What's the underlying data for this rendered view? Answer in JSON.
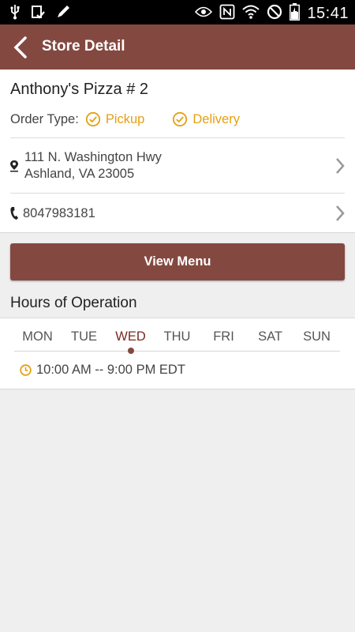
{
  "status_bar": {
    "time": "15:41"
  },
  "app_bar": {
    "title": "Store Detail"
  },
  "store": {
    "name": "Anthony's Pizza # 2",
    "order_type_label": "Order Type:",
    "order_types": [
      "Pickup",
      "Delivery"
    ],
    "address_line1": "111 N. Washington Hwy",
    "address_line2": "Ashland, VA 23005",
    "phone": "8047983181"
  },
  "menu_button": {
    "label": "View Menu"
  },
  "hours": {
    "title": "Hours of Operation",
    "days": [
      "MON",
      "TUE",
      "WED",
      "THU",
      "FRI",
      "SAT",
      "SUN"
    ],
    "selected_day": "WED",
    "time_range": "10:00 AM -- 9:00 PM EDT"
  },
  "colors": {
    "brand": "#834941",
    "accent": "#e6a012",
    "selected_day": "#7a2a22"
  },
  "icons": [
    "usb-icon",
    "clipboard-check-icon",
    "pencil-icon",
    "eye-icon",
    "nfc-icon",
    "wifi-icon",
    "no-signal-icon",
    "battery-icon",
    "back-icon",
    "check-circle-icon",
    "location-pin-icon",
    "phone-icon",
    "chevron-right-icon",
    "clock-icon"
  ]
}
